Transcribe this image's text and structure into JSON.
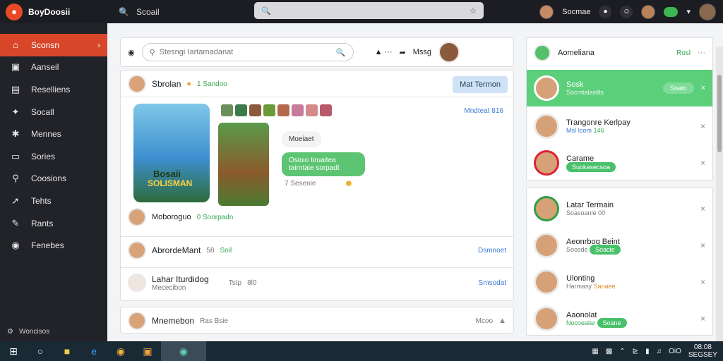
{
  "app": {
    "title": "BoyDoosii"
  },
  "topbar": {
    "search_label": "Scoail",
    "user_label": "Socmae"
  },
  "sidebar": {
    "items": [
      {
        "label": "Sconsn",
        "icon": "home-icon"
      },
      {
        "label": "Aanseil",
        "icon": "image-icon"
      },
      {
        "label": "Reselliens",
        "icon": "list-icon"
      },
      {
        "label": "Socall",
        "icon": "tag-icon"
      },
      {
        "label": "Mennes",
        "icon": "wrench-icon"
      },
      {
        "label": "Sories",
        "icon": "folder-icon"
      },
      {
        "label": "Coosions",
        "icon": "search-icon"
      },
      {
        "label": "Tehts",
        "icon": "pin-icon"
      },
      {
        "label": "Rants",
        "icon": "pencil-icon"
      },
      {
        "label": "Fenebes",
        "icon": "globe-icon"
      }
    ],
    "footer": "Woncisos"
  },
  "composer": {
    "placeholder": "Stesngi Iartamadanat",
    "action_label": "Mssg"
  },
  "feed": {
    "post_author": "Sbrolan",
    "post_meta": "1 Sandoo",
    "follow_label": "Mat Termon",
    "thumbs_meta": "Mndteat 816",
    "game_title": "Bosaii",
    "game_subtitle": "SOLISMAN",
    "msg1": "Moeiaet",
    "msg2": "Osioio tiruaitea tairntaie sorpadt",
    "msg_meta": "7 Sesenie",
    "comment_author": "Moboroguo",
    "comment_meta": "0 Soorpadn",
    "row1_name": "AbrordeMant",
    "row1_meta": "58",
    "row1_meta2": "Soil",
    "row1_action": "Dsmnoet",
    "row2_name": "Lahar Iturdidog",
    "row2_sub": "Mececibon",
    "row2_meta": "Tstp",
    "row2_meta2": "8l0",
    "row2_action": "Smsodat",
    "post2_author": "Mnemebon",
    "post2_meta": "Ras Bsie",
    "post2_action": "Mcoo"
  },
  "suggest": {
    "title": "Aomeliana",
    "action": "Rosl",
    "items": [
      {
        "name": "Sosk",
        "sub": "Socmtalasilts",
        "btn": "Soato"
      },
      {
        "name": "Trangonre Kerlpay",
        "sub": "Msl Icom",
        "meta": "146"
      },
      {
        "name": "Carame",
        "sub": "Suokasecsoa"
      }
    ]
  },
  "friends": {
    "items": [
      {
        "name": "Latar Termain",
        "sub": "Soasoanle",
        "meta": "00"
      },
      {
        "name": "Aeonrbog Beint",
        "sub": "Soosde",
        "tag": "Soacie"
      },
      {
        "name": "Ulonting",
        "sub": "Harmasy",
        "tag": "Sanaee"
      },
      {
        "name": "Aaonolat",
        "sub": "Nocoealar",
        "tag": "Soane"
      }
    ]
  },
  "taskbar": {
    "clock_time": "08:08",
    "clock_date": "SEGSEY",
    "tray": [
      "OiO"
    ]
  }
}
